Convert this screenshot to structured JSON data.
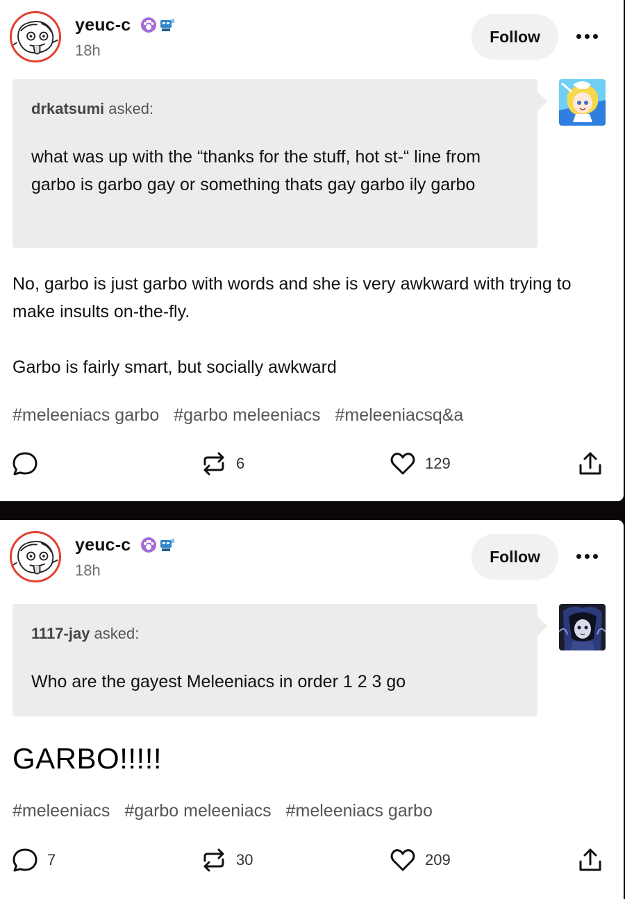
{
  "colors": {
    "follow_bg": "#f1f1f1",
    "ask_bg": "#ececec",
    "avatar_ring": "#e2412f",
    "page_bg": "#0b0708"
  },
  "icons": [
    "reply-icon",
    "reblog-icon",
    "like-icon",
    "share-icon",
    "more-icon",
    "paw-badge-icon",
    "robot-badge-icon"
  ],
  "posts": [
    {
      "author": "yeuc-c",
      "time": "18h",
      "follow_label": "Follow",
      "ask": {
        "asker": "drkatsumi",
        "asked_label": " asked:",
        "question": "what was up with the “thanks for the stuff, hot st-“ line from garbo is garbo gay or something thats gay garbo ily garbo"
      },
      "answer_paragraphs": [
        "No, garbo is just garbo with words and she is very awkward with trying to make insults on-the-fly.",
        "Garbo is fairly smart, but socially awkward"
      ],
      "tags": [
        "#meleeniacs garbo",
        "#garbo meleeniacs",
        "#meleeniacsq&a"
      ],
      "counts": {
        "replies": "",
        "reblogs": "6",
        "likes": "129"
      }
    },
    {
      "author": "yeuc-c",
      "time": "18h",
      "follow_label": "Follow",
      "ask": {
        "asker": "1117-jay",
        "asked_label": " asked:",
        "question": "Who are the gayest Meleeniacs in order 1 2 3 go"
      },
      "answer": "GARBO!!!!!",
      "tags": [
        "#meleeniacs",
        "#garbo meleeniacs",
        "#meleeniacs garbo"
      ],
      "counts": {
        "replies": "7",
        "reblogs": "30",
        "likes": "209"
      }
    }
  ]
}
